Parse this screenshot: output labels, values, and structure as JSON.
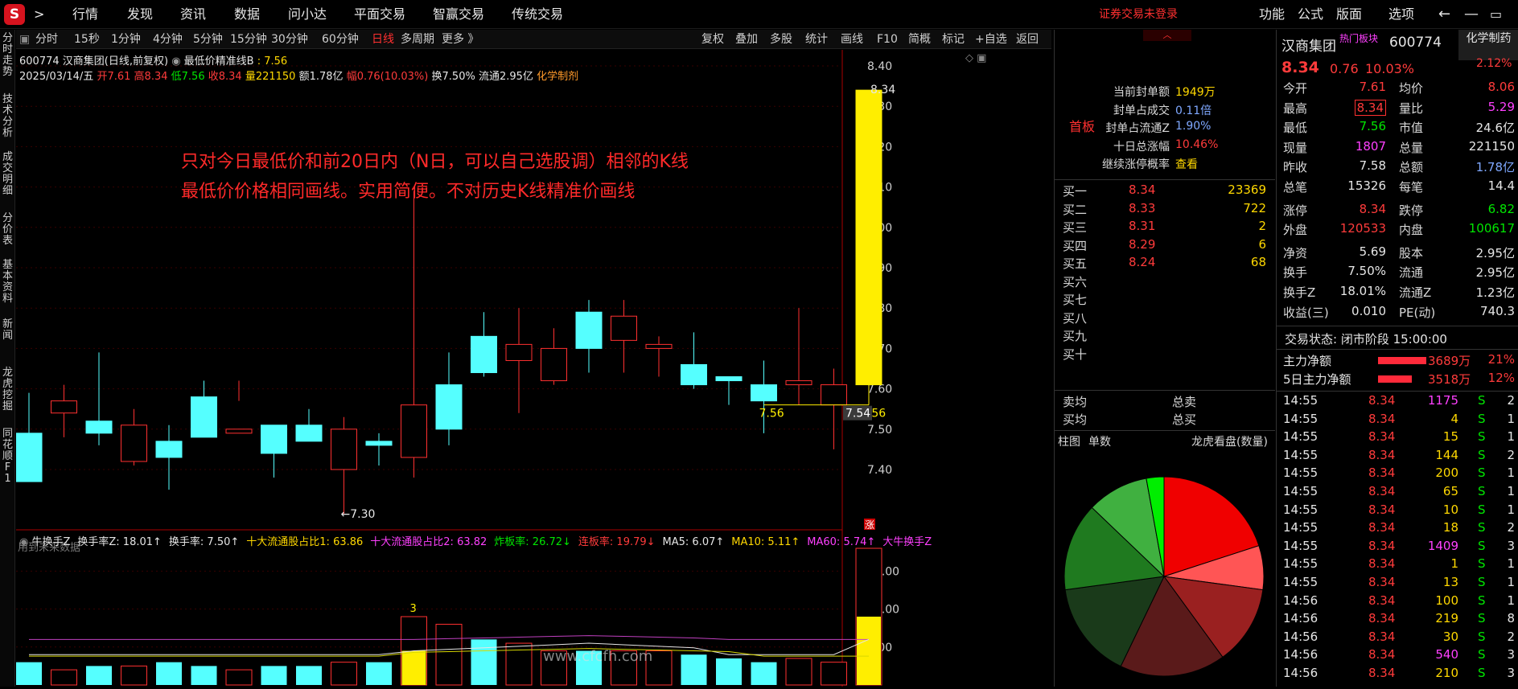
{
  "topbar": {
    "nav": [
      ">",
      "行情",
      "发现",
      "资讯",
      "数据",
      "问小达",
      "平面交易",
      "智赢交易",
      "传统交易"
    ],
    "trade_status": "证券交易未登录",
    "right": [
      "功能",
      "公式",
      "版面",
      "选项"
    ]
  },
  "toolbar": {
    "periods": [
      "分时",
      "15秒",
      "1分钟",
      "4分钟",
      "5分钟",
      "15分钟",
      "30分钟",
      "60分钟",
      "日线",
      "多周期",
      "更多 》"
    ],
    "tools": [
      "复权",
      "叠加",
      "多股",
      "统计",
      "画线",
      "F10",
      "简概",
      "标记",
      "+自选",
      "返回"
    ]
  },
  "left_tabs": [
    "分时走势",
    "技术分析",
    "成交明细",
    "分价表",
    "基本资料",
    "新闻",
    "龙虎挖掘",
    "同花顺F1"
  ],
  "header": {
    "line1_code": "600774 汉商集团(日线,前复权)",
    "line1_indicator": "最低价精准线B",
    "line1_value": ": 7.56",
    "date": "2025/03/14/五",
    "open": "开7.61",
    "high": "高8.34",
    "low": "低7.56",
    "close": "收8.34",
    "vol": "量221150",
    "amount": "额1.78亿",
    "change": "幅0.76(10.03%)",
    "turnover": "换7.50%",
    "float": "流通2.95亿",
    "sector": "化学制剂"
  },
  "annotation": {
    "line1": "只对今日最低价和前20日内（N日，可以自己选股调）相邻的K线",
    "line2": "最低价价格相同画线。实用简便。不对历史K线精准价画线"
  },
  "labels": {
    "future": "用到未来数据",
    "low_mark": "←7.30",
    "high_mark": "8.34",
    "line_left": "7.56",
    "line_right": "7.56",
    "price_tag": "7.54",
    "zhang": "涨",
    "bar_label": "3",
    "watermark": "www.cfcfh.com"
  },
  "price_axis": [
    "8.40",
    "8.30",
    "8.20",
    "8.10",
    "8.00",
    "7.90",
    "7.80",
    "7.70",
    "7.60",
    "7.50",
    "7.40"
  ],
  "indicator": {
    "items": [
      [
        "牛换手Z",
        "w"
      ],
      [
        "换手率Z: 18.01↑",
        "w"
      ],
      [
        "换手率: 7.50↑",
        "w"
      ],
      [
        "十大流通股占比1: 63.86",
        "y"
      ],
      [
        "十大流通股占比2: 63.82",
        "m"
      ],
      [
        "炸板率: 26.72↓",
        "g"
      ],
      [
        "连板率: 19.79↓",
        "r"
      ],
      [
        "MA5: 6.07↑",
        "w"
      ],
      [
        "MA10: 5.11↑",
        "y"
      ],
      [
        "MA60: 5.74↑",
        "m"
      ],
      [
        "大牛换手Z",
        "m"
      ]
    ],
    "axis": [
      "15.00",
      "10.00",
      "5.00"
    ]
  },
  "chart_data": {
    "type": "candlestick",
    "title": "600774 汉商集团(日线,前复权)",
    "ohlc": [
      [
        7.49,
        7.59,
        7.39,
        7.37
      ],
      [
        7.54,
        7.61,
        7.48,
        7.57
      ],
      [
        7.52,
        7.69,
        7.46,
        7.49
      ],
      [
        7.42,
        7.55,
        7.41,
        7.51
      ],
      [
        7.47,
        7.51,
        7.35,
        7.43
      ],
      [
        7.58,
        7.62,
        7.48,
        7.48
      ],
      [
        7.49,
        7.62,
        7.57,
        7.5
      ],
      [
        7.51,
        7.45,
        7.38,
        7.44
      ],
      [
        7.51,
        7.55,
        7.47,
        7.47
      ],
      [
        7.4,
        7.53,
        7.29,
        7.5
      ],
      [
        7.47,
        7.49,
        7.41,
        7.46
      ],
      [
        7.43,
        8.09,
        7.38,
        7.56
      ],
      [
        7.61,
        7.69,
        7.46,
        7.5
      ],
      [
        7.73,
        7.79,
        7.63,
        7.64
      ],
      [
        7.67,
        7.8,
        7.54,
        7.71
      ],
      [
        7.62,
        7.75,
        7.61,
        7.7
      ],
      [
        7.79,
        7.82,
        7.64,
        7.7
      ],
      [
        7.72,
        7.82,
        7.64,
        7.78
      ],
      [
        7.7,
        7.73,
        7.63,
        7.71
      ],
      [
        7.66,
        7.74,
        7.6,
        7.61
      ],
      [
        7.63,
        7.63,
        7.56,
        7.62
      ],
      [
        7.61,
        7.67,
        7.49,
        7.57
      ],
      [
        7.61,
        7.8,
        7.56,
        7.62
      ],
      [
        7.56,
        7.65,
        7.45,
        7.61
      ],
      [
        7.61,
        8.34,
        7.56,
        8.34
      ]
    ],
    "turnover": [
      3,
      2,
      2.5,
      2.5,
      3,
      2.5,
      2,
      2.5,
      2.5,
      3,
      3,
      9,
      8,
      6,
      5.5,
      4.5,
      4.5,
      4.5,
      4.5,
      4,
      3.5,
      3,
      3.5,
      3,
      18
    ],
    "ylim": [
      7.2,
      8.44
    ]
  },
  "orderbook": {
    "first_board": "首板",
    "stats": [
      [
        "当前封单额",
        "1949万",
        "y"
      ],
      [
        "封单占成交",
        "0.11倍",
        "b"
      ],
      [
        "封单占流通Z",
        "1.90%",
        "b"
      ],
      [
        "十日总涨幅",
        "10.46%",
        "r"
      ],
      [
        "继续涨停概率",
        "查看",
        "y"
      ]
    ],
    "bids": [
      [
        "买一",
        "8.34",
        "23369"
      ],
      [
        "买二",
        "8.33",
        "722"
      ],
      [
        "买三",
        "8.31",
        "2"
      ],
      [
        "买四",
        "8.29",
        "6"
      ],
      [
        "买五",
        "8.24",
        "68"
      ],
      [
        "买六",
        "",
        ""
      ],
      [
        "买七",
        "",
        ""
      ],
      [
        "买八",
        "",
        ""
      ],
      [
        "买九",
        "",
        ""
      ],
      [
        "买十",
        "",
        ""
      ]
    ],
    "avg": [
      [
        "卖均",
        "总卖"
      ],
      [
        "买均",
        "总买"
      ]
    ],
    "tabs": [
      "柱图",
      "单数",
      "龙虎看盘(数量)"
    ]
  },
  "pie": {
    "slices": [
      {
        "value": 70,
        "color": "#f00000"
      },
      {
        "value": 25,
        "color": "#ff5555"
      },
      {
        "value": 45,
        "color": "#9a2020"
      },
      {
        "value": 60,
        "color": "#5a1a1a"
      },
      {
        "value": 55,
        "color": "#1a3a1a"
      },
      {
        "value": 50,
        "color": "#1f7a1f"
      },
      {
        "value": 35,
        "color": "#40b040"
      },
      {
        "value": 10,
        "color": "#00ee00"
      }
    ]
  },
  "quote": {
    "name": "汉商集团",
    "tag": "热门板块",
    "code": "600774",
    "sector": "化学制药",
    "price": "8.34",
    "chg": "0.76",
    "pct": "10.03%",
    "pct2": "2.12%",
    "grid": [
      [
        "今开",
        "7.61",
        "r",
        "均价",
        "8.06",
        "r"
      ],
      [
        "最高",
        "8.34",
        "r",
        "量比",
        "5.29",
        "m"
      ],
      [
        "最低",
        "7.56",
        "g",
        "市值",
        "24.6亿",
        "w"
      ],
      [
        "现量",
        "1807",
        "m",
        "总量",
        "221150",
        "w"
      ],
      [
        "昨收",
        "7.58",
        "w",
        "总额",
        "1.78亿",
        "b"
      ],
      [
        "总笔",
        "15326",
        "w",
        "每笔",
        "14.4",
        "w"
      ],
      [
        "涨停",
        "8.34",
        "r",
        "跌停",
        "6.82",
        "g"
      ],
      [
        "外盘",
        "120533",
        "r",
        "内盘",
        "100617",
        "g"
      ],
      [
        "净资",
        "5.69",
        "w",
        "股本",
        "2.95亿",
        "w"
      ],
      [
        "换手",
        "7.50%",
        "w",
        "流通",
        "2.95亿",
        "w"
      ],
      [
        "换手Z",
        "18.01%",
        "w",
        "流通Z",
        "1.23亿",
        "w"
      ],
      [
        "收益(三)",
        "0.010",
        "w",
        "PE(动)",
        "740.3",
        "w"
      ]
    ],
    "status": "交易状态: 闭市阶段 15:00:00",
    "flow": [
      [
        "主力净额",
        "3689万",
        "21%"
      ],
      [
        "5日主力净额",
        "3518万",
        "12%"
      ]
    ],
    "ticks": [
      [
        "14:55",
        "8.34",
        "1175",
        "2"
      ],
      [
        "14:55",
        "8.34",
        "4",
        "1"
      ],
      [
        "14:55",
        "8.34",
        "15",
        "1"
      ],
      [
        "14:55",
        "8.34",
        "144",
        "2"
      ],
      [
        "14:55",
        "8.34",
        "200",
        "1"
      ],
      [
        "14:55",
        "8.34",
        "65",
        "1"
      ],
      [
        "14:55",
        "8.34",
        "10",
        "1"
      ],
      [
        "14:55",
        "8.34",
        "18",
        "2"
      ],
      [
        "14:55",
        "8.34",
        "1409",
        "3"
      ],
      [
        "14:55",
        "8.34",
        "1",
        "1"
      ],
      [
        "14:55",
        "8.34",
        "13",
        "1"
      ],
      [
        "14:56",
        "8.34",
        "100",
        "1"
      ],
      [
        "14:56",
        "8.34",
        "219",
        "8"
      ],
      [
        "14:56",
        "8.34",
        "30",
        "2"
      ],
      [
        "14:56",
        "8.34",
        "540",
        "3"
      ],
      [
        "14:56",
        "8.34",
        "210",
        "3"
      ]
    ]
  }
}
